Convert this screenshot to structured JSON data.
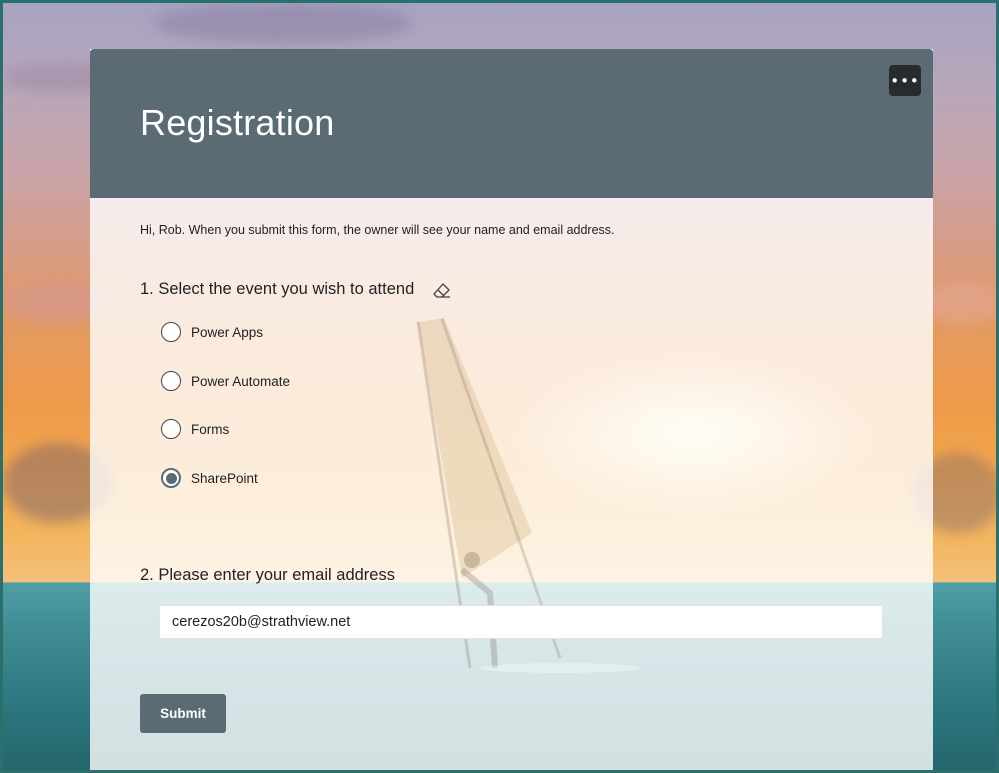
{
  "form": {
    "title": "Registration",
    "more_icon": "ellipsis-icon",
    "more_label": "•••",
    "notice": "Hi, Rob. When you submit this form, the owner will see your name and email address."
  },
  "question1": {
    "title": "1. Select the event you wish to attend",
    "clear_icon": "eraser-icon",
    "options": [
      {
        "label": "Power Apps",
        "selected": false
      },
      {
        "label": "Power Automate",
        "selected": false
      },
      {
        "label": "Forms",
        "selected": false
      },
      {
        "label": "SharePoint",
        "selected": true
      }
    ]
  },
  "question2": {
    "title": "2. Please enter your email address",
    "value": "cerezos20b@strathview.net"
  },
  "submit": {
    "label": "Submit"
  },
  "colors": {
    "header": "#5a6b74",
    "menu_button": "#272b2d",
    "submit": "#5a6b74"
  }
}
